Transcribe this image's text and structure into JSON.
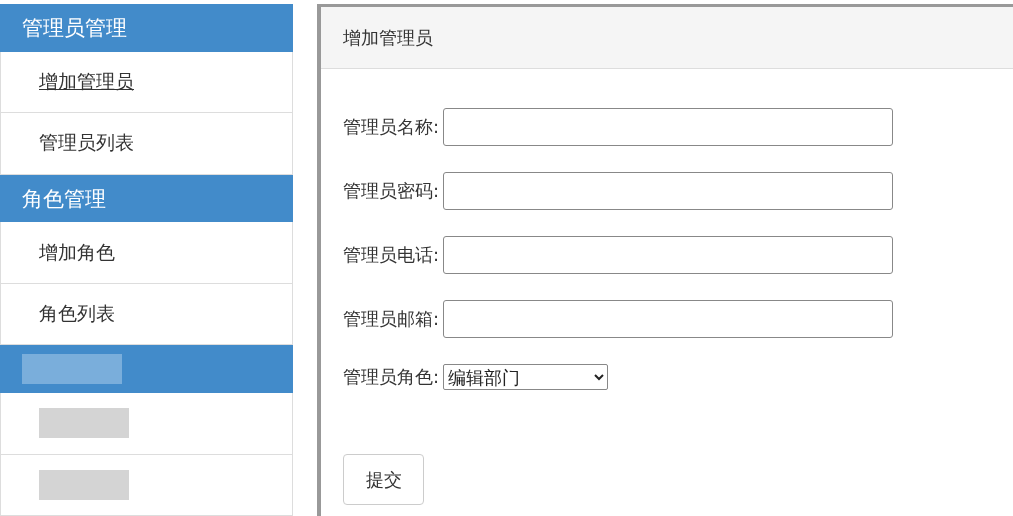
{
  "sidebar": {
    "sections": [
      {
        "kind": "normal",
        "title": "管理员管理",
        "items": [
          {
            "kind": "normal",
            "label": "增加管理员",
            "selected": true
          },
          {
            "kind": "normal",
            "label": "管理员列表",
            "selected": false
          }
        ]
      },
      {
        "kind": "normal",
        "title": "角色管理",
        "items": [
          {
            "kind": "normal",
            "label": "增加角色",
            "selected": false
          },
          {
            "kind": "normal",
            "label": "角色列表",
            "selected": false
          }
        ]
      },
      {
        "kind": "redacted",
        "items": [
          {
            "kind": "redacted"
          },
          {
            "kind": "redacted"
          }
        ]
      }
    ]
  },
  "panel": {
    "title": "增加管理员",
    "fields": [
      {
        "kind": "input",
        "label": "管理员名称:"
      },
      {
        "kind": "input",
        "label": "管理员密码:"
      },
      {
        "kind": "input",
        "label": "管理员电话:"
      },
      {
        "kind": "input",
        "label": "管理员邮箱:"
      },
      {
        "kind": "select",
        "label": "管理员角色:",
        "value": "编辑部门"
      }
    ],
    "submit": "提交"
  }
}
